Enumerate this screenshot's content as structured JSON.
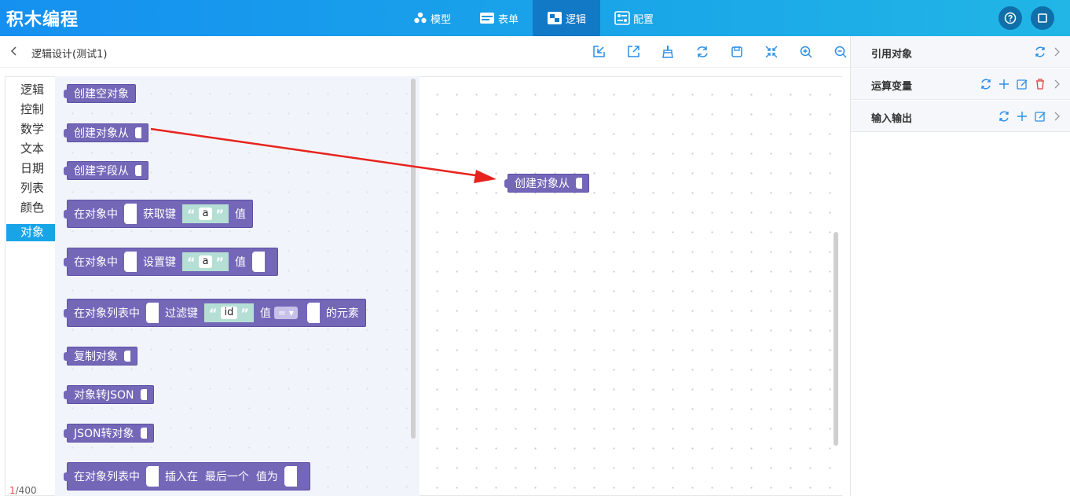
{
  "app": {
    "title": "积木编程"
  },
  "nav": [
    {
      "label": "模型"
    },
    {
      "label": "表单"
    },
    {
      "label": "逻辑"
    },
    {
      "label": "配置"
    }
  ],
  "toolbar": {
    "title": "逻辑设计(测试1)"
  },
  "categories": [
    "逻辑",
    "控制",
    "数学",
    "文本",
    "日期",
    "列表",
    "颜色",
    "对象"
  ],
  "selected_category": "对象",
  "counter": {
    "current": "1",
    "total": "/400"
  },
  "blocks": {
    "create_empty": "创建空对象",
    "create_from": "创建对象从",
    "create_field_from": "创建字段从",
    "get_key": {
      "prefix": "在对象中",
      "mid": "获取键",
      "key": "a",
      "suffix": "值"
    },
    "set_key": {
      "prefix": "在对象中",
      "mid": "设置键",
      "key": "a",
      "suffix": "值"
    },
    "filter": {
      "prefix": "在对象列表中",
      "mid": "过滤键",
      "key": "id",
      "val": "值",
      "op": "=",
      "suffix": "的元素"
    },
    "copy": "复制对象",
    "to_json": "对象转JSON",
    "from_json": "JSON转对象",
    "insert": {
      "prefix": "在对象列表中",
      "mid": "插入在",
      "pos": "最后一个",
      "val": "值为"
    }
  },
  "canvas_block": "创建对象从",
  "quote_open": "“",
  "quote_close": "”",
  "right_panel": [
    {
      "label": "引用对象"
    },
    {
      "label": "运算变量"
    },
    {
      "label": "输入输出"
    }
  ],
  "colors": {
    "header": "#1590f0",
    "block": "#7467b8",
    "string": "#b5dfd5",
    "arrow": "#e8231e",
    "selected": "#1aa4e8"
  }
}
